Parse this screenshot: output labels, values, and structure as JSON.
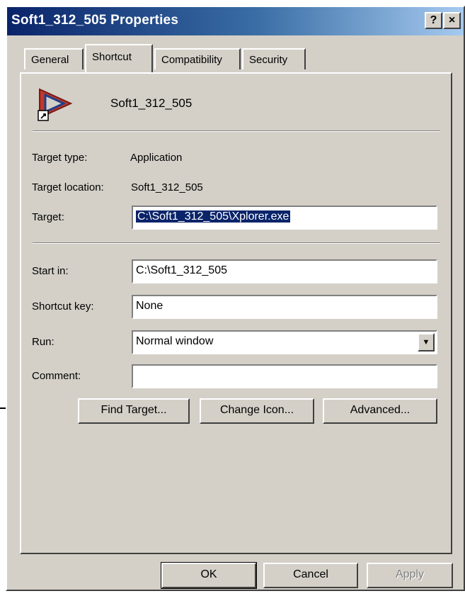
{
  "window": {
    "title": "Soft1_312_505 Properties",
    "help_button": "?",
    "close_button": "×"
  },
  "tabs": [
    {
      "label": "General",
      "active": false
    },
    {
      "label": "Shortcut",
      "active": true
    },
    {
      "label": "Compatibility",
      "active": false
    },
    {
      "label": "Security",
      "active": false
    }
  ],
  "shortcut": {
    "name": "Soft1_312_505",
    "icon": "shortcut-app-icon",
    "target_type_label": "Target type:",
    "target_type_value": "Application",
    "target_location_label": "Target location:",
    "target_location_value": "Soft1_312_505",
    "target_label": "Target:",
    "target_value": "C:\\Soft1_312_505\\Xplorer.exe",
    "start_in_label": "Start in:",
    "start_in_value": "C:\\Soft1_312_505",
    "shortcut_key_label": "Shortcut key:",
    "shortcut_key_value": "None",
    "run_label": "Run:",
    "run_value": "Normal window",
    "comment_label": "Comment:",
    "comment_value": ""
  },
  "buttons": {
    "find_target": "Find Target...",
    "change_icon": "Change Icon...",
    "advanced": "Advanced...",
    "ok": "OK",
    "cancel": "Cancel",
    "apply": "Apply"
  }
}
